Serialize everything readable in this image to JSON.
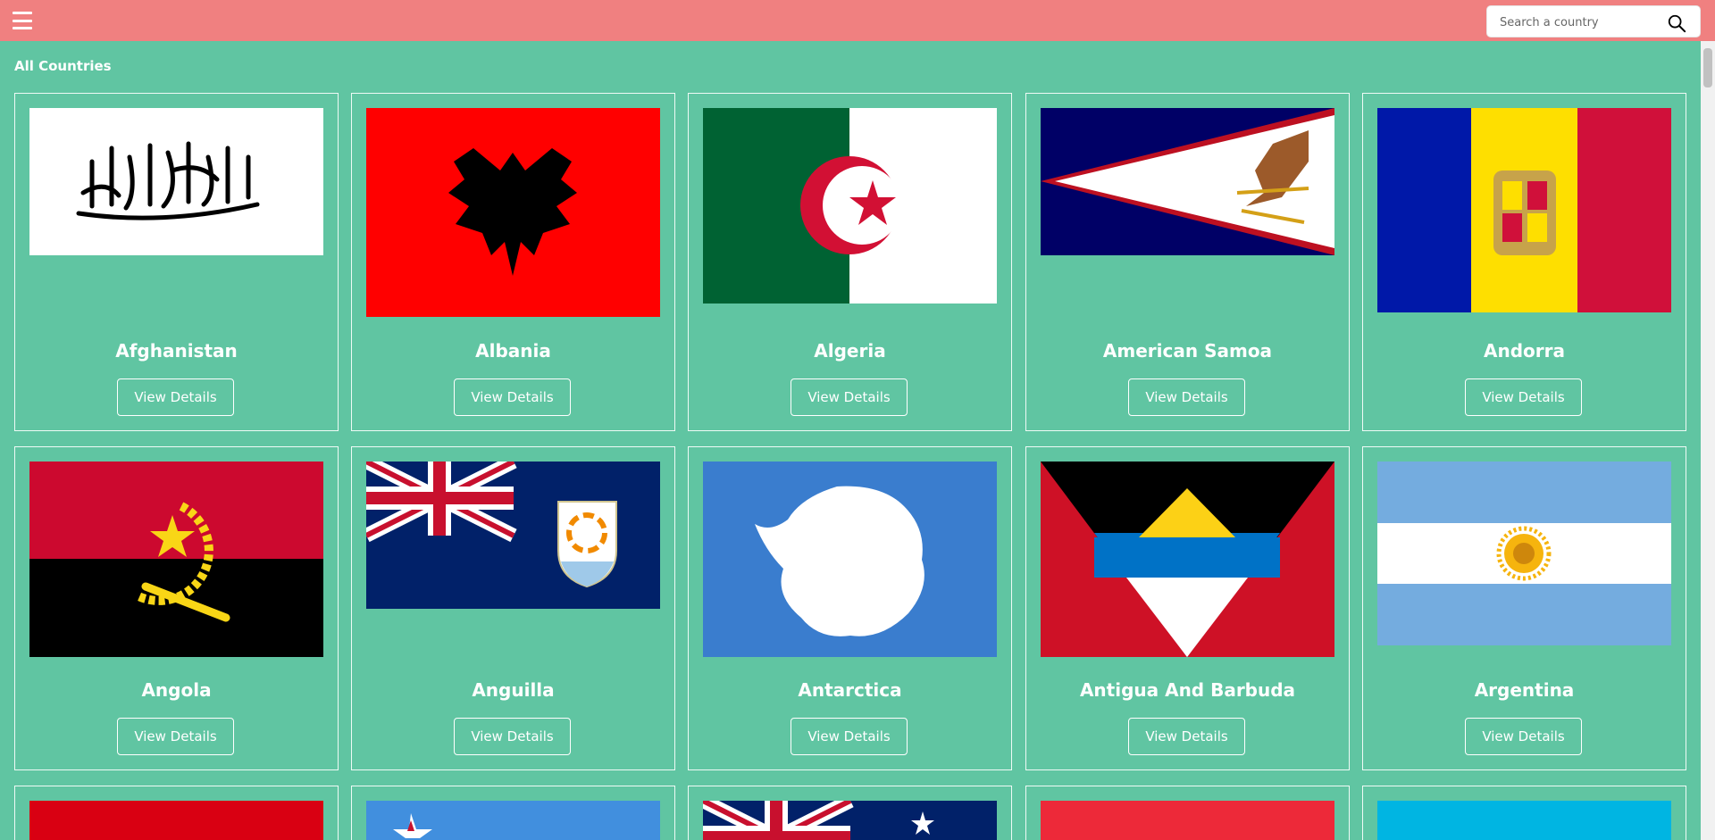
{
  "header": {
    "menu_icon": "hamburger-menu-icon",
    "search_placeholder": "Search a country",
    "search_icon": "search-icon",
    "bar_color": "#f08080"
  },
  "page": {
    "title": "All Countries",
    "background_color": "#60c5a2"
  },
  "countries": [
    {
      "name": "Afghanistan",
      "button": "View Details"
    },
    {
      "name": "Albania",
      "button": "View Details"
    },
    {
      "name": "Algeria",
      "button": "View Details"
    },
    {
      "name": "American Samoa",
      "button": "View Details"
    },
    {
      "name": "Andorra",
      "button": "View Details"
    },
    {
      "name": "Angola",
      "button": "View Details"
    },
    {
      "name": "Anguilla",
      "button": "View Details"
    },
    {
      "name": "Antarctica",
      "button": "View Details"
    },
    {
      "name": "Antigua And Barbuda",
      "button": "View Details"
    },
    {
      "name": "Argentina",
      "button": "View Details"
    }
  ]
}
